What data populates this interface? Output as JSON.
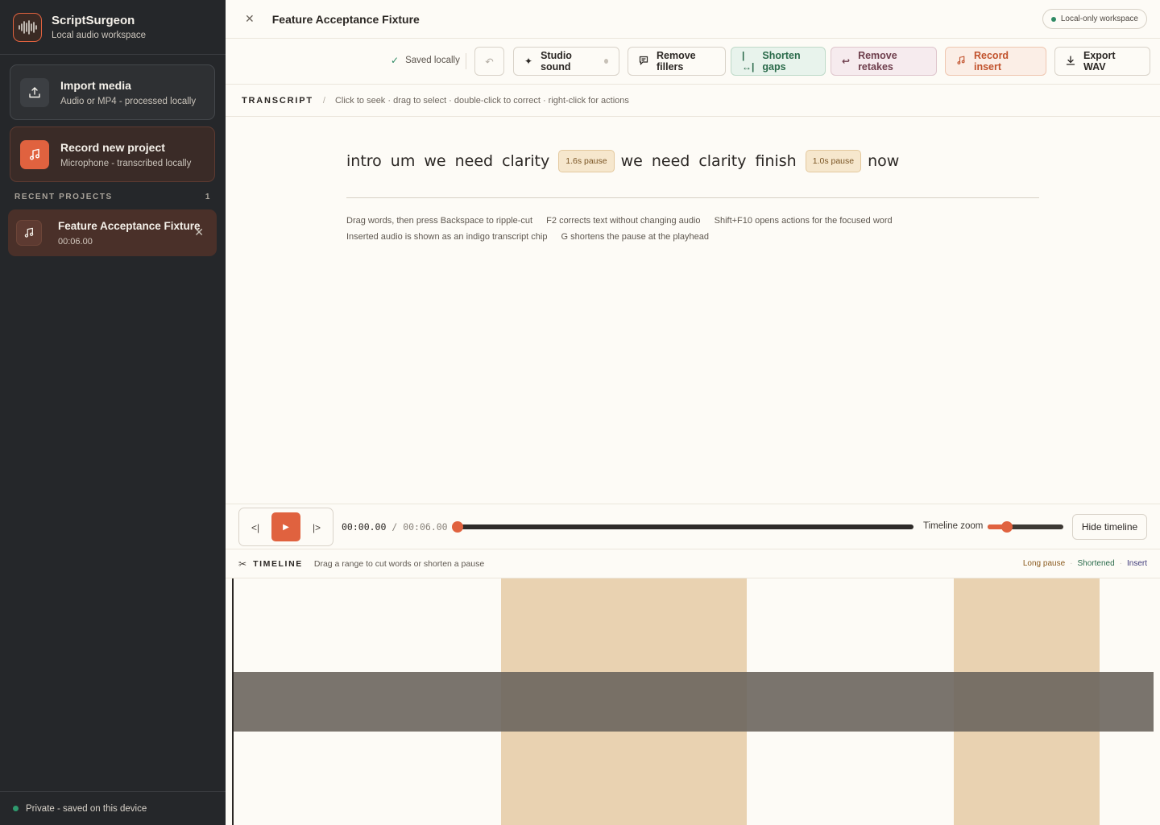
{
  "app": {
    "name": "ScriptSurgeon",
    "tagline": "Local audio workspace"
  },
  "sidebar": {
    "import": {
      "title": "Import media",
      "subtitle": "Audio or MP4 - processed locally"
    },
    "record": {
      "title": "Record new project",
      "subtitle": "Microphone - transcribed locally"
    },
    "recent_label": "RECENT PROJECTS",
    "recent_count": "1",
    "recent_items": [
      {
        "title": "Feature Acceptance Fixture",
        "duration": "00:06.00"
      }
    ],
    "footer": "Private - saved on this device"
  },
  "header": {
    "title": "Feature Acceptance Fixture",
    "badge": "Local-only workspace"
  },
  "toolbar": {
    "saved": "Saved locally",
    "studio_sound": "Studio sound",
    "remove_fillers": "Remove fillers",
    "shorten_gaps": "Shorten gaps",
    "remove_retakes": "Remove retakes",
    "record_insert": "Record insert",
    "export": "Export WAV"
  },
  "transcript": {
    "label": "TRANSCRIPT",
    "hint": "Click to seek · drag to select · double-click to correct · right-click for actions",
    "words": [
      "intro",
      "um",
      "we",
      "need",
      "clarity",
      "1.6s pause",
      "we",
      "need",
      "clarity",
      "finish",
      "1.0s pause",
      "now"
    ],
    "tips_line1": [
      "Drag words, then press Backspace to ripple-cut",
      "F2 corrects text without changing audio",
      "Shift+F10 opens actions for the focused word"
    ],
    "tips_line2": [
      "Inserted audio is shown as an indigo transcript chip",
      "G shortens the pause at the playhead"
    ]
  },
  "player": {
    "current": "00:00.00",
    "separator": "/",
    "duration": "00:06.00",
    "progress": 0,
    "zoom_label": "Timeline zoom",
    "zoom_level": 0.25,
    "hide_timeline": "Hide timeline"
  },
  "timeline": {
    "label": "TIMELINE",
    "hint": "Drag a range to cut words or shorten a pause",
    "legend": [
      "Long pause",
      "Shortened",
      "Insert"
    ],
    "legend_sep": "·"
  },
  "colors": {
    "accent": "#e0623f",
    "sidebar_bg": "#25272a",
    "pause_fill": "#e9d2b1",
    "success": "#2f8a64"
  }
}
